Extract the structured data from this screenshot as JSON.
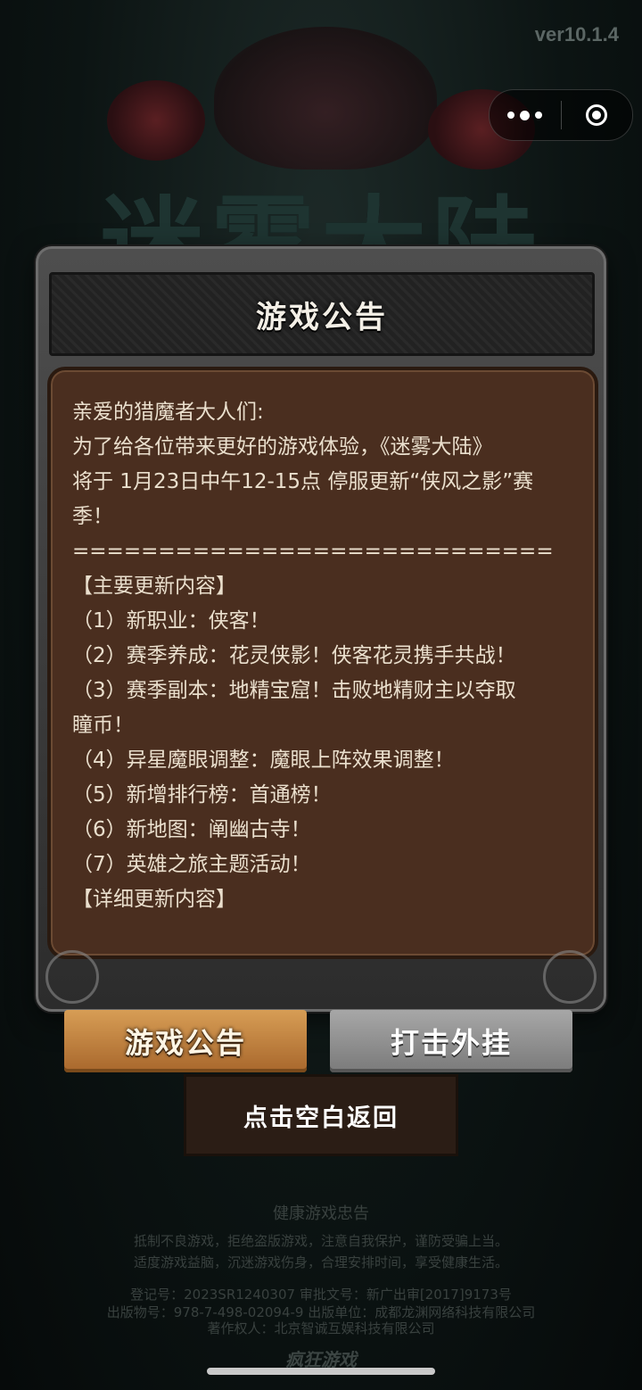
{
  "version": "ver10.1.4",
  "bg_logo": "迷雾大陆",
  "panel": {
    "title": "游戏公告",
    "lines": [
      "亲爱的猎魔者大人们:",
      "为了给各位带来更好的游戏体验，《迷雾大陆》",
      "将于 1月23日中午12-15点 停服更新“侠风之影”赛",
      "季！",
      "============================",
      "【主要更新内容】",
      "（1）新职业：侠客！",
      "（2）赛季养成：花灵侠影！侠客花灵携手共战！",
      "（3）赛季副本：地精宝窟！击败地精财主以夺取",
      "瞳币！",
      "（4）异星魔眼调整：魔眼上阵效果调整！",
      "（5）新增排行榜：首通榜！",
      "（6）新地图：阐幽古寺！",
      "（7）英雄之旅主题活动！",
      "",
      "【详细更新内容】"
    ]
  },
  "buttons": {
    "notice": "游戏公告",
    "anticheat": "打击外挂",
    "return": "点击空白返回"
  },
  "footer": {
    "title": "健康游戏忠告",
    "line1": "抵制不良游戏，拒绝盗版游戏，注意自我保护，谨防受骗上当。",
    "line2": "适度游戏益脑，沉迷游戏伤身，合理安排时间，享受健康生活。",
    "line3": "登记号：2023SR1240307    审批文号：新广出审[2017]9173号",
    "line4": "出版物号：978-7-498-02094-9    出版单位：成都龙渊网络科技有限公司",
    "line5": "著作权人：北京智诚互娱科技有限公司",
    "logo": "疯狂游戏"
  }
}
